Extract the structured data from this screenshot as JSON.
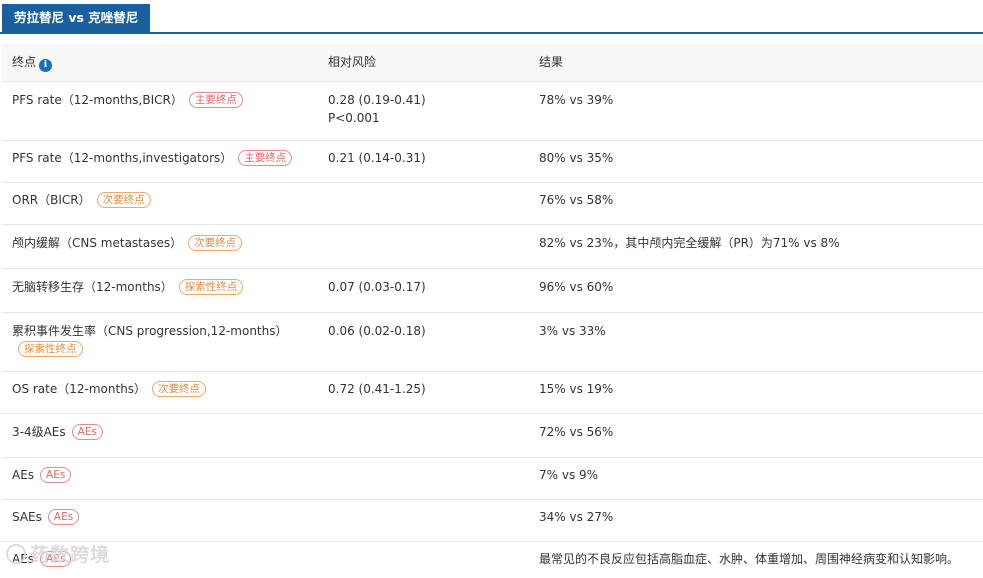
{
  "tab": {
    "label": "劳拉替尼 vs 克唑替尼"
  },
  "header": {
    "endpoint": "终点",
    "info_icon": "i",
    "risk": "相对风险",
    "result": "结果"
  },
  "rows": [
    {
      "endpoint": "PFS rate（12-months,BICR）",
      "tag": "主要终点",
      "risk": "0.28 (0.19-0.41)",
      "risk_p": "P<0.001",
      "result": "78% vs 39%"
    },
    {
      "endpoint": "PFS rate（12-months,investigators）",
      "tag": "主要终点",
      "risk": "0.21 (0.14-0.31)",
      "result": "80% vs 35%"
    },
    {
      "endpoint": "ORR（BICR）",
      "tag": "次要终点",
      "risk": "",
      "result": "76% vs 58%"
    },
    {
      "endpoint": "颅内缓解（CNS metastases）",
      "tag": "次要终点",
      "risk": "",
      "result": "82% vs 23%，其中颅内完全缓解（PR）为71% vs 8%"
    },
    {
      "endpoint": "无脑转移生存（12-months）",
      "tag": "探索性终点",
      "risk": "0.07 (0.03-0.17)",
      "result": "96% vs 60%"
    },
    {
      "endpoint": "累积事件发生率（CNS progression,12-months）",
      "tag": "探索性终点",
      "risk": "0.06 (0.02-0.18)",
      "result": "3% vs 33%"
    },
    {
      "endpoint": "OS rate（12-months）",
      "tag": "次要终点",
      "risk": "0.72 (0.41-1.25)",
      "result": "15% vs 19%"
    },
    {
      "endpoint": "3-4级AEs",
      "tag": "AEs",
      "risk": "",
      "result": "72% vs 56%"
    },
    {
      "endpoint": "AEs",
      "tag": "AEs",
      "risk": "",
      "result": "7% vs 9%"
    },
    {
      "endpoint": "SAEs",
      "tag": "AEs",
      "risk": "",
      "result": "34% vs 27%"
    },
    {
      "endpoint": "AEs",
      "tag": "AEs",
      "risk": "",
      "result": "最常见的不良反应包括高脂血症、水肿、体重增加、周围神经病变和认知影响。"
    }
  ],
  "watermark": {
    "text": "药数跨境"
  }
}
